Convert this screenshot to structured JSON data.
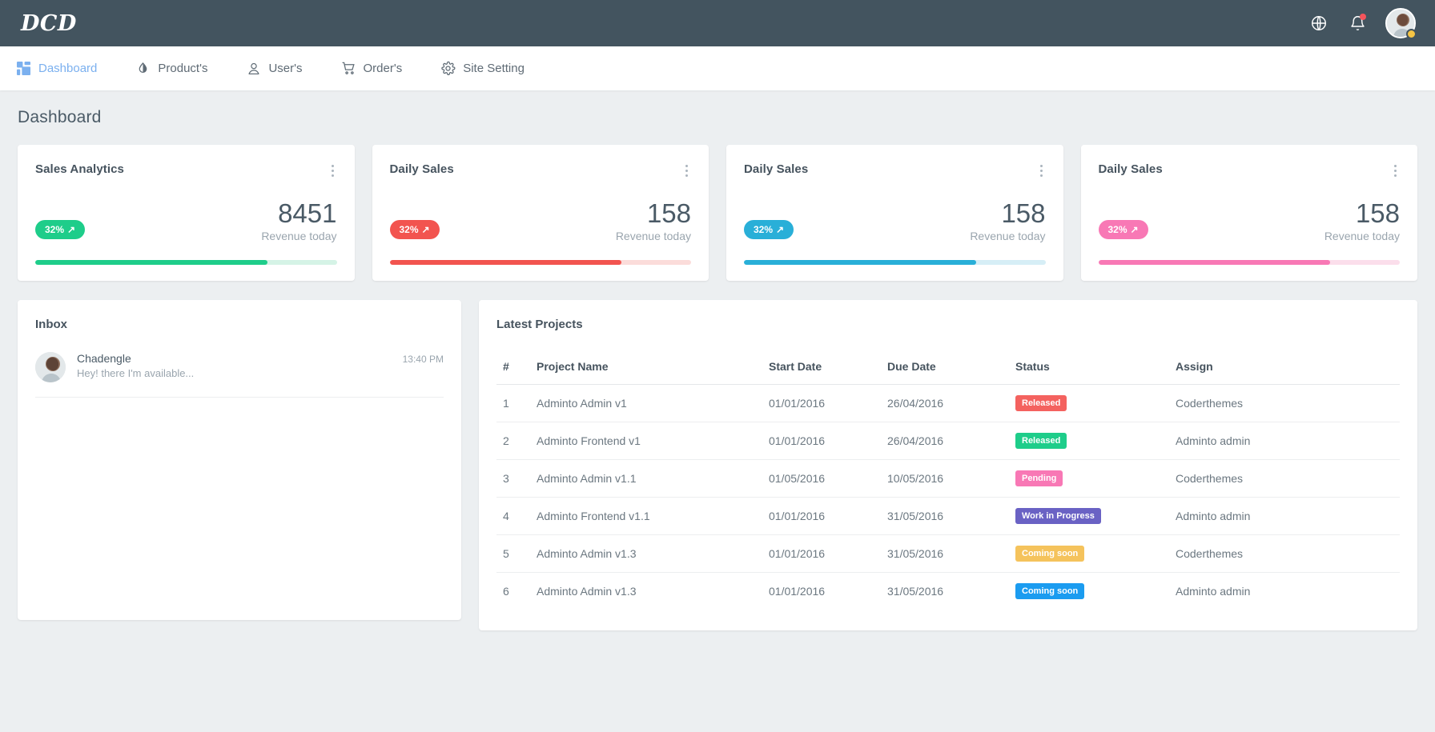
{
  "header": {
    "brand": "DCD",
    "icons": [
      {
        "name": "globe-icon",
        "label": "Language"
      },
      {
        "name": "bell-icon",
        "label": "Notifications",
        "has_dot": true
      },
      {
        "name": "avatar",
        "label": "Profile"
      }
    ]
  },
  "nav": {
    "items": [
      {
        "label": "Dashboard",
        "icon": "grid-icon",
        "active": true
      },
      {
        "label": "Product's",
        "icon": "droplet-icon",
        "active": false
      },
      {
        "label": "User's",
        "icon": "user-icon",
        "active": false
      },
      {
        "label": "Order's",
        "icon": "cart-icon",
        "active": false
      },
      {
        "label": "Site Setting",
        "icon": "gear-icon",
        "active": false
      }
    ]
  },
  "page": {
    "title": "Dashboard"
  },
  "stat_cards": [
    {
      "title": "Sales Analytics",
      "badge": "32%",
      "arrow": "↗",
      "value": "8451",
      "label": "Revenue today",
      "color": "#1ecd8a",
      "track": "#d5f3e6",
      "progress_pct": 77
    },
    {
      "title": "Daily Sales",
      "badge": "32%",
      "arrow": "↗",
      "value": "158",
      "label": "Revenue today",
      "color": "#f2544f",
      "track": "#fbdcda",
      "progress_pct": 77
    },
    {
      "title": "Daily Sales",
      "badge": "32%",
      "arrow": "↗",
      "value": "158",
      "label": "Revenue today",
      "color": "#29afd8",
      "track": "#d6eef6",
      "progress_pct": 77
    },
    {
      "title": "Daily Sales",
      "badge": "32%",
      "arrow": "↗",
      "value": "158",
      "label": "Revenue today",
      "color": "#f878b5",
      "track": "#fbdeeb",
      "progress_pct": 77
    }
  ],
  "inbox": {
    "title": "Inbox",
    "messages": [
      {
        "name": "Chadengle",
        "preview": "Hey! there I'm available...",
        "time": "13:40 PM"
      }
    ]
  },
  "projects": {
    "title": "Latest Projects",
    "columns": [
      "#",
      "Project Name",
      "Start Date",
      "Due Date",
      "Status",
      "Assign"
    ],
    "rows": [
      {
        "num": "1",
        "name": "Adminto Admin v1",
        "start": "01/01/2016",
        "due": "26/04/2016",
        "status": "Released",
        "status_color": "#f4625f",
        "assign": "Coderthemes"
      },
      {
        "num": "2",
        "name": "Adminto Frontend v1",
        "start": "01/01/2016",
        "due": "26/04/2016",
        "status": "Released",
        "status_color": "#1ecd8a",
        "assign": "Adminto admin"
      },
      {
        "num": "3",
        "name": "Adminto Admin v1.1",
        "start": "01/05/2016",
        "due": "10/05/2016",
        "status": "Pending",
        "status_color": "#f878b5",
        "assign": "Coderthemes"
      },
      {
        "num": "4",
        "name": "Adminto Frontend v1.1",
        "start": "01/01/2016",
        "due": "31/05/2016",
        "status": "Work in Progress",
        "status_color": "#6a62c4",
        "assign": "Adminto admin"
      },
      {
        "num": "5",
        "name": "Adminto Admin v1.3",
        "start": "01/01/2016",
        "due": "31/05/2016",
        "status": "Coming soon",
        "status_color": "#f5c35c",
        "assign": "Coderthemes"
      },
      {
        "num": "6",
        "name": "Adminto Admin v1.3",
        "start": "01/01/2016",
        "due": "31/05/2016",
        "status": "Coming soon",
        "status_color": "#1b9cf0",
        "assign": "Adminto admin"
      }
    ]
  }
}
